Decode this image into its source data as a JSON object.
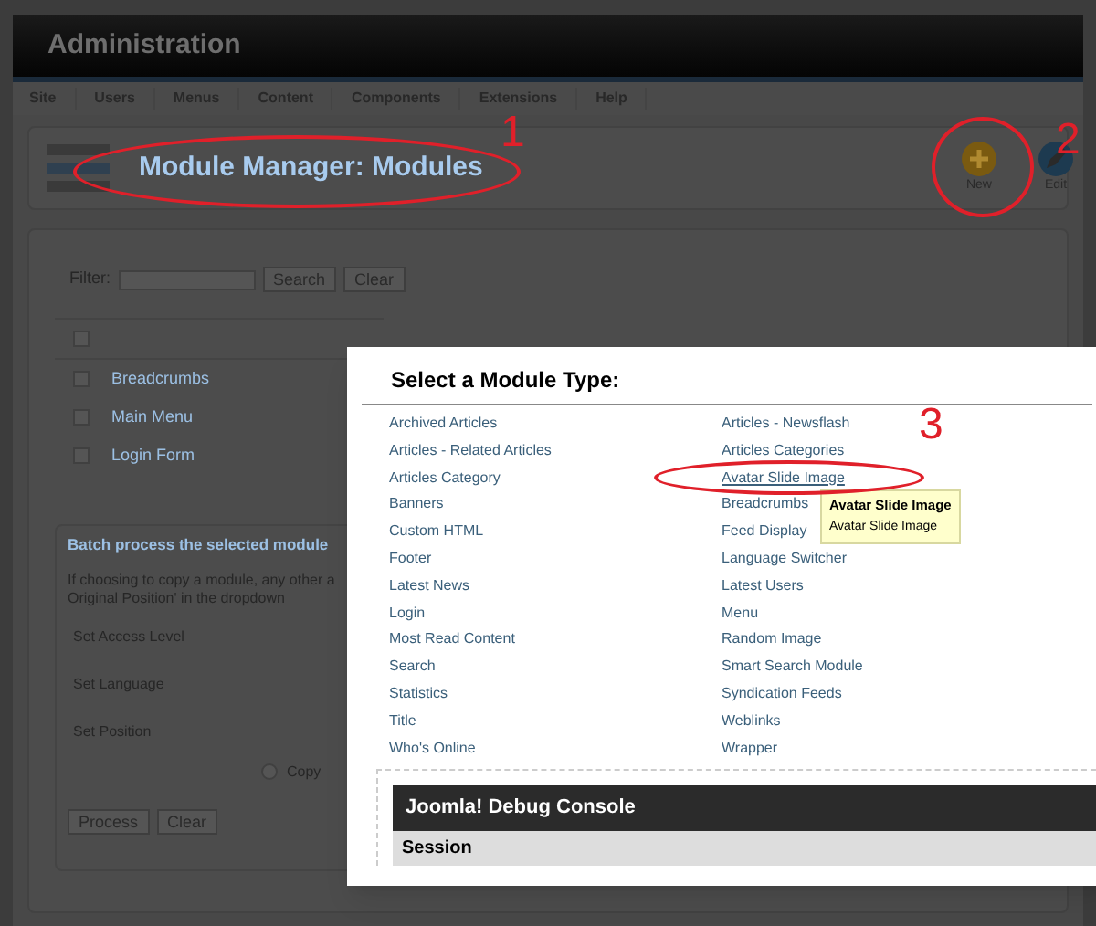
{
  "header": {
    "title": "Administration"
  },
  "menu": [
    {
      "label": "Site"
    },
    {
      "label": "Users"
    },
    {
      "label": "Menus"
    },
    {
      "label": "Content"
    },
    {
      "label": "Components"
    },
    {
      "label": "Extensions"
    },
    {
      "label": "Help"
    }
  ],
  "toolbar": {
    "title": "Module Manager: Modules",
    "buttons": [
      {
        "label": "New",
        "kind": "new"
      },
      {
        "label": "Edit",
        "kind": "edit"
      }
    ]
  },
  "filter": {
    "label": "Filter:",
    "buttons": [
      "Search",
      "Clear"
    ]
  },
  "select_all": {
    "checked": false
  },
  "rows": [
    {
      "name": "Breadcrumbs",
      "checked": false
    },
    {
      "name": "Main Menu",
      "checked": false
    },
    {
      "name": "Login Form",
      "checked": false
    }
  ],
  "batch": {
    "legend": "Batch process the selected module",
    "info_lines": [
      "If choosing to copy a module, any other a",
      "Original Position' in the dropdown"
    ],
    "fields": [
      "Set Access Level",
      "Set Language",
      "Set Position"
    ],
    "radio": {
      "label": "Copy",
      "selected": false
    },
    "buttons": [
      "Process",
      "Clear"
    ]
  },
  "modal": {
    "title": "Select a Module Type:",
    "columns": [
      [
        {
          "label": "Archived Articles",
          "hovered": false
        },
        {
          "label": "Articles - Related Articles",
          "hovered": false
        },
        {
          "label": "Articles Category",
          "hovered": false
        },
        {
          "label": "Banners",
          "hovered": false
        },
        {
          "label": "Custom HTML",
          "hovered": false
        },
        {
          "label": "Footer",
          "hovered": false
        },
        {
          "label": "Latest News",
          "hovered": false
        },
        {
          "label": "Login",
          "hovered": false
        },
        {
          "label": "Most Read Content",
          "hovered": false
        },
        {
          "label": "Search",
          "hovered": false
        },
        {
          "label": "Statistics",
          "hovered": false
        },
        {
          "label": "Title",
          "hovered": false
        },
        {
          "label": "Who's Online",
          "hovered": false
        }
      ],
      [
        {
          "label": "Articles - Newsflash",
          "hovered": false
        },
        {
          "label": "Articles Categories",
          "hovered": false
        },
        {
          "label": "Avatar Slide Image",
          "hovered": true
        },
        {
          "label": "Breadcrumbs",
          "hovered": false
        },
        {
          "label": "Feed Display",
          "hovered": false
        },
        {
          "label": "Language Switcher",
          "hovered": false
        },
        {
          "label": "Latest Users",
          "hovered": false
        },
        {
          "label": "Menu",
          "hovered": false
        },
        {
          "label": "Random Image",
          "hovered": false
        },
        {
          "label": "Smart Search Module",
          "hovered": false
        },
        {
          "label": "Syndication Feeds",
          "hovered": false
        },
        {
          "label": "Weblinks",
          "hovered": false
        },
        {
          "label": "Wrapper",
          "hovered": false
        }
      ]
    ],
    "tooltip": {
      "title": "Avatar Slide Image",
      "text": "Avatar Slide Image"
    },
    "debug": {
      "title": "Joomla! Debug Console",
      "section": "Session"
    }
  },
  "annotations": [
    {
      "label": "1"
    },
    {
      "label": "2"
    },
    {
      "label": "3"
    }
  ]
}
